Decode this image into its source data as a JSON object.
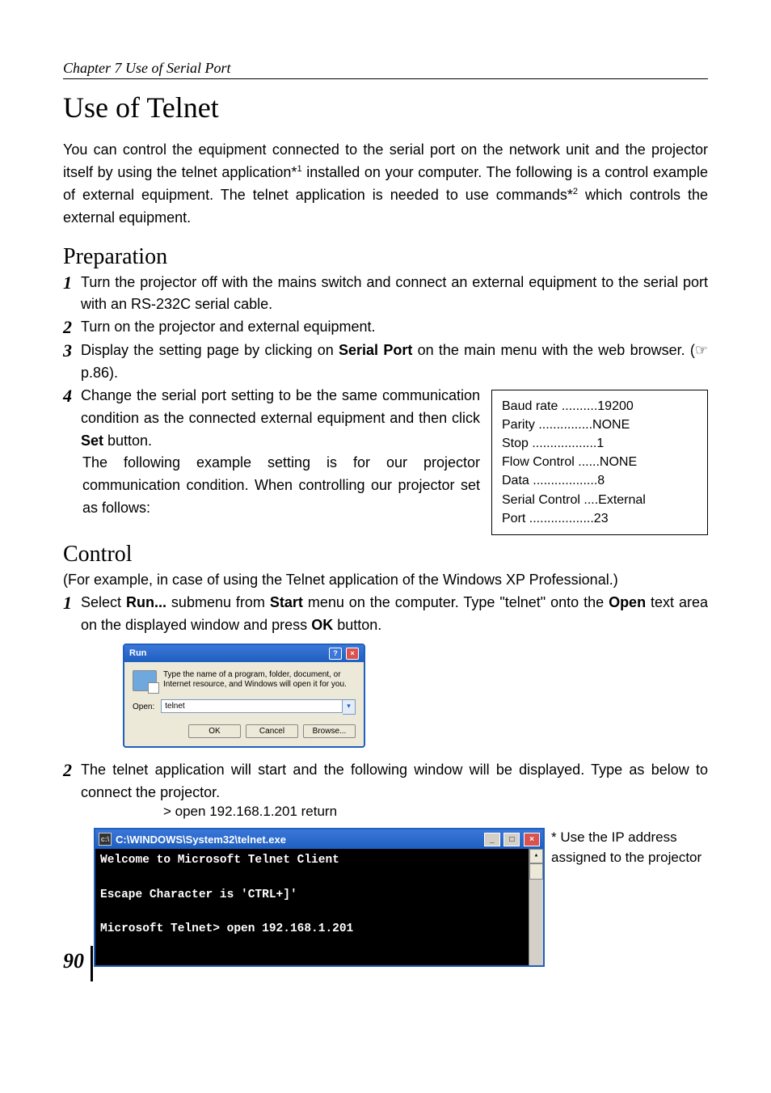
{
  "chapter": "Chapter 7 Use of Serial Port",
  "h1": "Use of Telnet",
  "intro_a": "You can control the equipment connected to the serial port on the network unit and the projector itself by using the telnet application*",
  "intro_b": " installed on your computer. The following is a control example of external equipment. The telnet application is needed to use commands*",
  "intro_c": " which controls the external equipment.",
  "sup1": "1",
  "sup2": "2",
  "prep_h": "Preparation",
  "prep": {
    "s1": "Turn the projector off with the mains switch and connect an external equipment to the serial port with an RS-232C serial cable.",
    "s2": "Turn on the projector and external equipment.",
    "s3a": "Display the setting page by clicking on ",
    "s3b": "Serial Port",
    "s3c": " on the main menu with the web browser. (☞ p.86).",
    "s4a": "Change the serial port setting to be the same communication condition as the connected external equipment and then click ",
    "s4b": "Set",
    "s4c": " button.",
    "s4_sub": "The following example setting is for our projector communication condition. When controlling our projector set as follows:"
  },
  "settings_box": "Baud rate ..........19200\nParity ...............NONE\nStop ..................1\nFlow Control ......NONE\nData ..................8\nSerial Control ....External\nPort ..................23",
  "control_h": "Control",
  "control_note": "(For example, in case of using the Telnet application of the Windows XP Professional.)",
  "ctrl": {
    "s1a": "Select ",
    "s1b": "Run...",
    "s1c": " submenu from ",
    "s1d": "Start",
    "s1e": " menu on the computer. Type \"telnet\" onto the ",
    "s1f": "Open",
    "s1g": " text area on the displayed window and press ",
    "s1h": "OK",
    "s1i": " button.",
    "s2": "The telnet application will start and the following window will be displayed. Type as below to connect the projector.",
    "cmd": "> open 192.168.1.201 return"
  },
  "run": {
    "title": "Run",
    "desc": "Type the name of a program, folder, document, or Internet resource, and Windows will open it for you.",
    "open_label": "Open:",
    "open_value": "telnet",
    "ok": "OK",
    "cancel": "Cancel",
    "browse": "Browse..."
  },
  "console": {
    "title": "C:\\WINDOWS\\System32\\telnet.exe",
    "line1": "Welcome to Microsoft Telnet Client",
    "line2": "Escape Character is 'CTRL+]'",
    "line3": "Microsoft Telnet> open 192.168.1.201"
  },
  "side_note": "* Use the IP address assigned to the projector",
  "page_num": "90",
  "nums": {
    "n1": "1",
    "n2": "2",
    "n3": "3",
    "n4": "4"
  }
}
